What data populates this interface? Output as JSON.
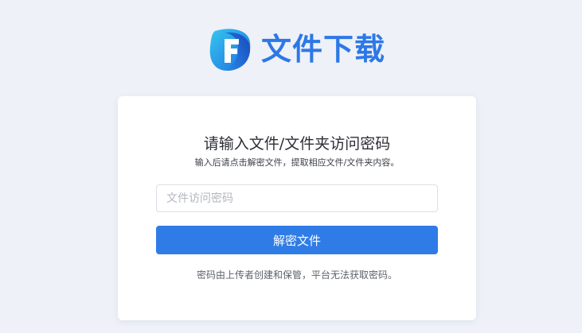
{
  "brand": {
    "title": "文件下载",
    "icon": "file-f-logo-icon",
    "color": "#2d78e8"
  },
  "card": {
    "title": "请输入文件/文件夹访问密码",
    "subtitle": "输入后请点击解密文件，提取相应文件/文件夹内容。",
    "password_input": {
      "value": "",
      "placeholder": "文件访问密码"
    },
    "submit_label": "解密文件",
    "footnote": "密码由上传者创建和保管，平台无法获取密码。"
  },
  "colors": {
    "background": "#eef1f7",
    "accent": "#2f7ce6",
    "card": "#ffffff"
  }
}
